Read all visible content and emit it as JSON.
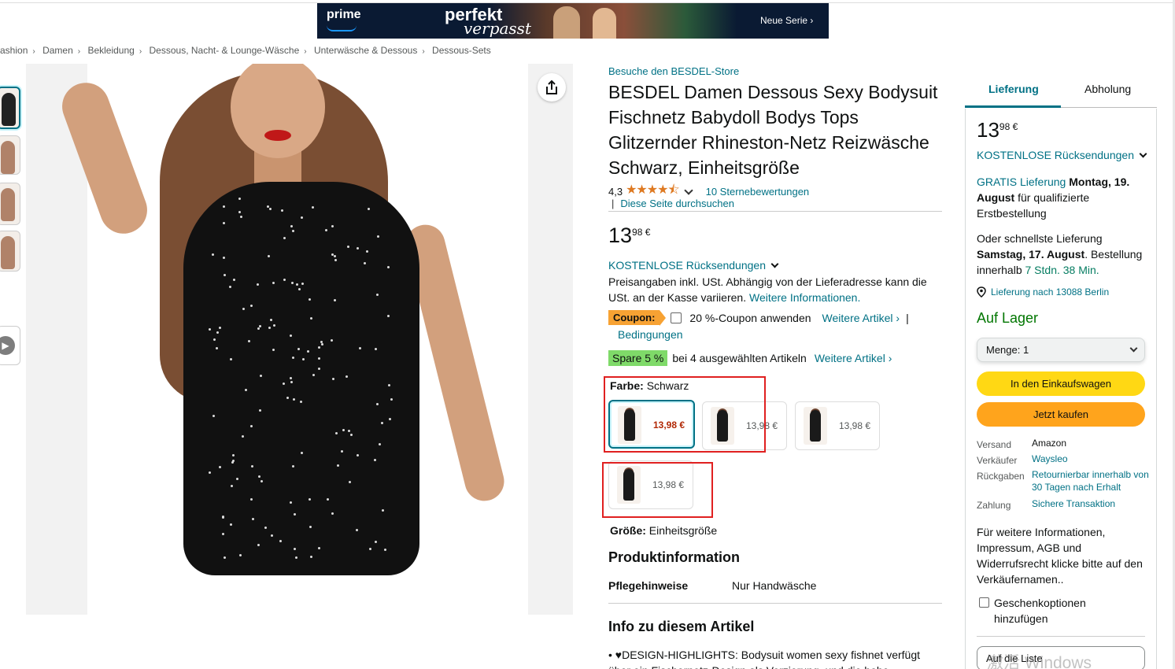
{
  "banner": {
    "prime": "prime",
    "title_line1": "perfekt",
    "title_line2": "verpasst",
    "cta": "Neue Serie ›"
  },
  "breadcrumb": [
    "ashion",
    "Damen",
    "Bekleidung",
    "Dessous, Nacht- & Lounge-Wäsche",
    "Unterwäsche & Dessous",
    "Dessous-Sets"
  ],
  "product": {
    "store_link": "Besuche den BESDEL-Store",
    "title": "BESDEL Damen Dessous Sexy Bodysuit Fischnetz Babydoll Bodys Tops Glitzernder Rhineston-Netz Reizwäsche Schwarz, Einheitsgröße",
    "rating_value": "4,3",
    "stars": "★★★★⯪",
    "rating_count": "10 Sternebewertungen",
    "search_page": "Diese Seite durchsuchen",
    "price_whole": "13",
    "price_fraction": "98 €",
    "free_returns": "KOSTENLOSE Rücksendungen",
    "price_note": "Preisangaben inkl. USt. Abhängig von der Lieferadresse kann die USt. an der Kasse variieren.",
    "more_info": "Weitere Informationen.",
    "coupon_badge": "Coupon:",
    "coupon_text": "20 %-Coupon anwenden",
    "coupon_more": "Weitere Artikel ›",
    "coupon_pipe": "|",
    "coupon_conditions": "Bedingungen",
    "spare_badge": "Spare 5 %",
    "spare_text": "bei 4 ausgewählten Artikeln",
    "spare_more": "Weitere Artikel ›",
    "color_label": "Farbe:",
    "color_value": "Schwarz",
    "swatches": [
      {
        "price": "13,98 €",
        "selected": true
      },
      {
        "price": "13,98 €",
        "selected": false
      },
      {
        "price": "13,98 €",
        "selected": false
      },
      {
        "price": "13,98 €",
        "selected": false
      }
    ],
    "size_label": "Größe:",
    "size_value": "Einheitsgröße",
    "product_info_heading": "Produktinformation",
    "care_key": "Pflegehinweise",
    "care_value": "Nur Handwäsche",
    "about_heading": "Info zu diesem Artikel",
    "bullet_1": "♥DESIGN-HIGHLIGHTS: Bodysuit women sexy fishnet verfügt über ein Fischernetz-Design als Verzierung, und die hohe"
  },
  "buybox": {
    "tab_delivery": "Lieferung",
    "tab_pickup": "Abholung",
    "price_whole": "13",
    "price_fraction": "98 €",
    "free_returns": "KOSTENLOSE Rücksendungen",
    "free_delivery_link": "GRATIS Lieferung",
    "delivery_date": "Montag, 19. August",
    "delivery_suffix": "für qualifizierte Erstbestellung",
    "fastest_prefix": "Oder schnellste Lieferung",
    "fastest_date": "Samstag, 17. August",
    "order_within": ". Bestellung innerhalb",
    "countdown": "7 Stdn. 38 Min.",
    "location": "Lieferung nach 13088 Berlin",
    "stock": "Auf Lager",
    "quantity": "Menge:  1",
    "add_to_cart": "In den Einkaufswagen",
    "buy_now": "Jetzt kaufen",
    "ships_from_key": "Versand",
    "ships_from_val": "Amazon",
    "seller_key": "Verkäufer",
    "seller_val": "Waysleo",
    "returns_key": "Rückgaben",
    "returns_val": "Retournierbar innerhalb von 30 Tagen nach Erhalt",
    "payment_key": "Zahlung",
    "payment_val": "Sichere Transaktion",
    "seller_info": "Für weitere Informationen, Impressum, AGB und Widerrufsrecht klicke bitte auf den Verkäufernamen..",
    "gift_options": "Geschenkoptionen hinzufügen",
    "add_to_list": "Auf die Liste"
  },
  "watermark": "激活 Windows",
  "colors": {
    "link": "#007185",
    "cart": "#ffd814",
    "buy": "#ffa41c",
    "coupon": "#f7a233",
    "spare": "#7fda69",
    "stock": "#007600",
    "highlight": "#e02020"
  }
}
